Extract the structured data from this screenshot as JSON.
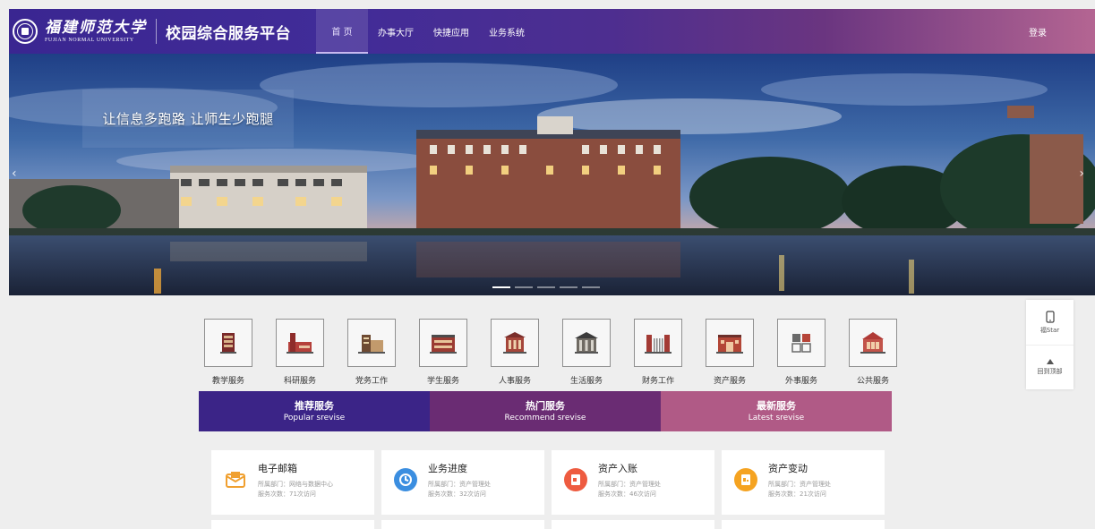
{
  "header": {
    "logo_cn": "福建师范大学",
    "logo_en": "FUJIAN NORMAL UNIVERSITY",
    "platform_title": "校园综合服务平台",
    "nav": [
      {
        "label": "首 页",
        "active": true
      },
      {
        "label": "办事大厅",
        "active": false
      },
      {
        "label": "快捷应用",
        "active": false
      },
      {
        "label": "业务系统",
        "active": false
      }
    ],
    "login_label": "登录"
  },
  "banner": {
    "slogan": "让信息多跑路 让师生少跑腿",
    "prev_arrow": "‹",
    "next_arrow": "›",
    "slide_count": 5,
    "active_slide": 0
  },
  "services": [
    {
      "label": "教学服务",
      "icon": "teaching-building-icon"
    },
    {
      "label": "科研服务",
      "icon": "research-building-icon"
    },
    {
      "label": "党务工作",
      "icon": "party-building-icon"
    },
    {
      "label": "学生服务",
      "icon": "student-building-icon"
    },
    {
      "label": "人事服务",
      "icon": "personnel-building-icon"
    },
    {
      "label": "生活服务",
      "icon": "life-building-icon"
    },
    {
      "label": "财务工作",
      "icon": "finance-building-icon"
    },
    {
      "label": "资产服务",
      "icon": "asset-building-icon"
    },
    {
      "label": "外事服务",
      "icon": "foreign-affairs-icon"
    },
    {
      "label": "公共服务",
      "icon": "public-building-icon"
    }
  ],
  "tabs": [
    {
      "cn": "推荐服务",
      "en": "Popular srevise",
      "active": true
    },
    {
      "cn": "热门服务",
      "en": "Recommend srevise",
      "active": false
    },
    {
      "cn": "最新服务",
      "en": "Latest srevise",
      "active": false
    }
  ],
  "cards": [
    {
      "title": "电子邮箱",
      "dept": "所属部门：网络与数据中心",
      "count": "服务次数：71次访问",
      "icon": "mail-icon",
      "color": "#f0a030"
    },
    {
      "title": "业务进度",
      "dept": "所属部门：资产管理处",
      "count": "服务次数：32次访问",
      "icon": "progress-clock-icon",
      "color": "#3b8ee0"
    },
    {
      "title": "资产入账",
      "dept": "所属部门：资产管理处",
      "count": "服务次数：46次访问",
      "icon": "asset-entry-icon",
      "color": "#ee5b40"
    },
    {
      "title": "资产变动",
      "dept": "所属部门：资产管理处",
      "count": "服务次数：21次访问",
      "icon": "asset-change-icon",
      "color": "#f5a321"
    }
  ],
  "float_panel": {
    "app_label": "福Star",
    "top_label": "回到顶部"
  },
  "colors": {
    "header_start": "#3a2691",
    "header_end": "#b46592",
    "tab_popular": "#3b2487",
    "tab_recommend": "#6a2c73",
    "tab_latest": "#b05a86"
  }
}
